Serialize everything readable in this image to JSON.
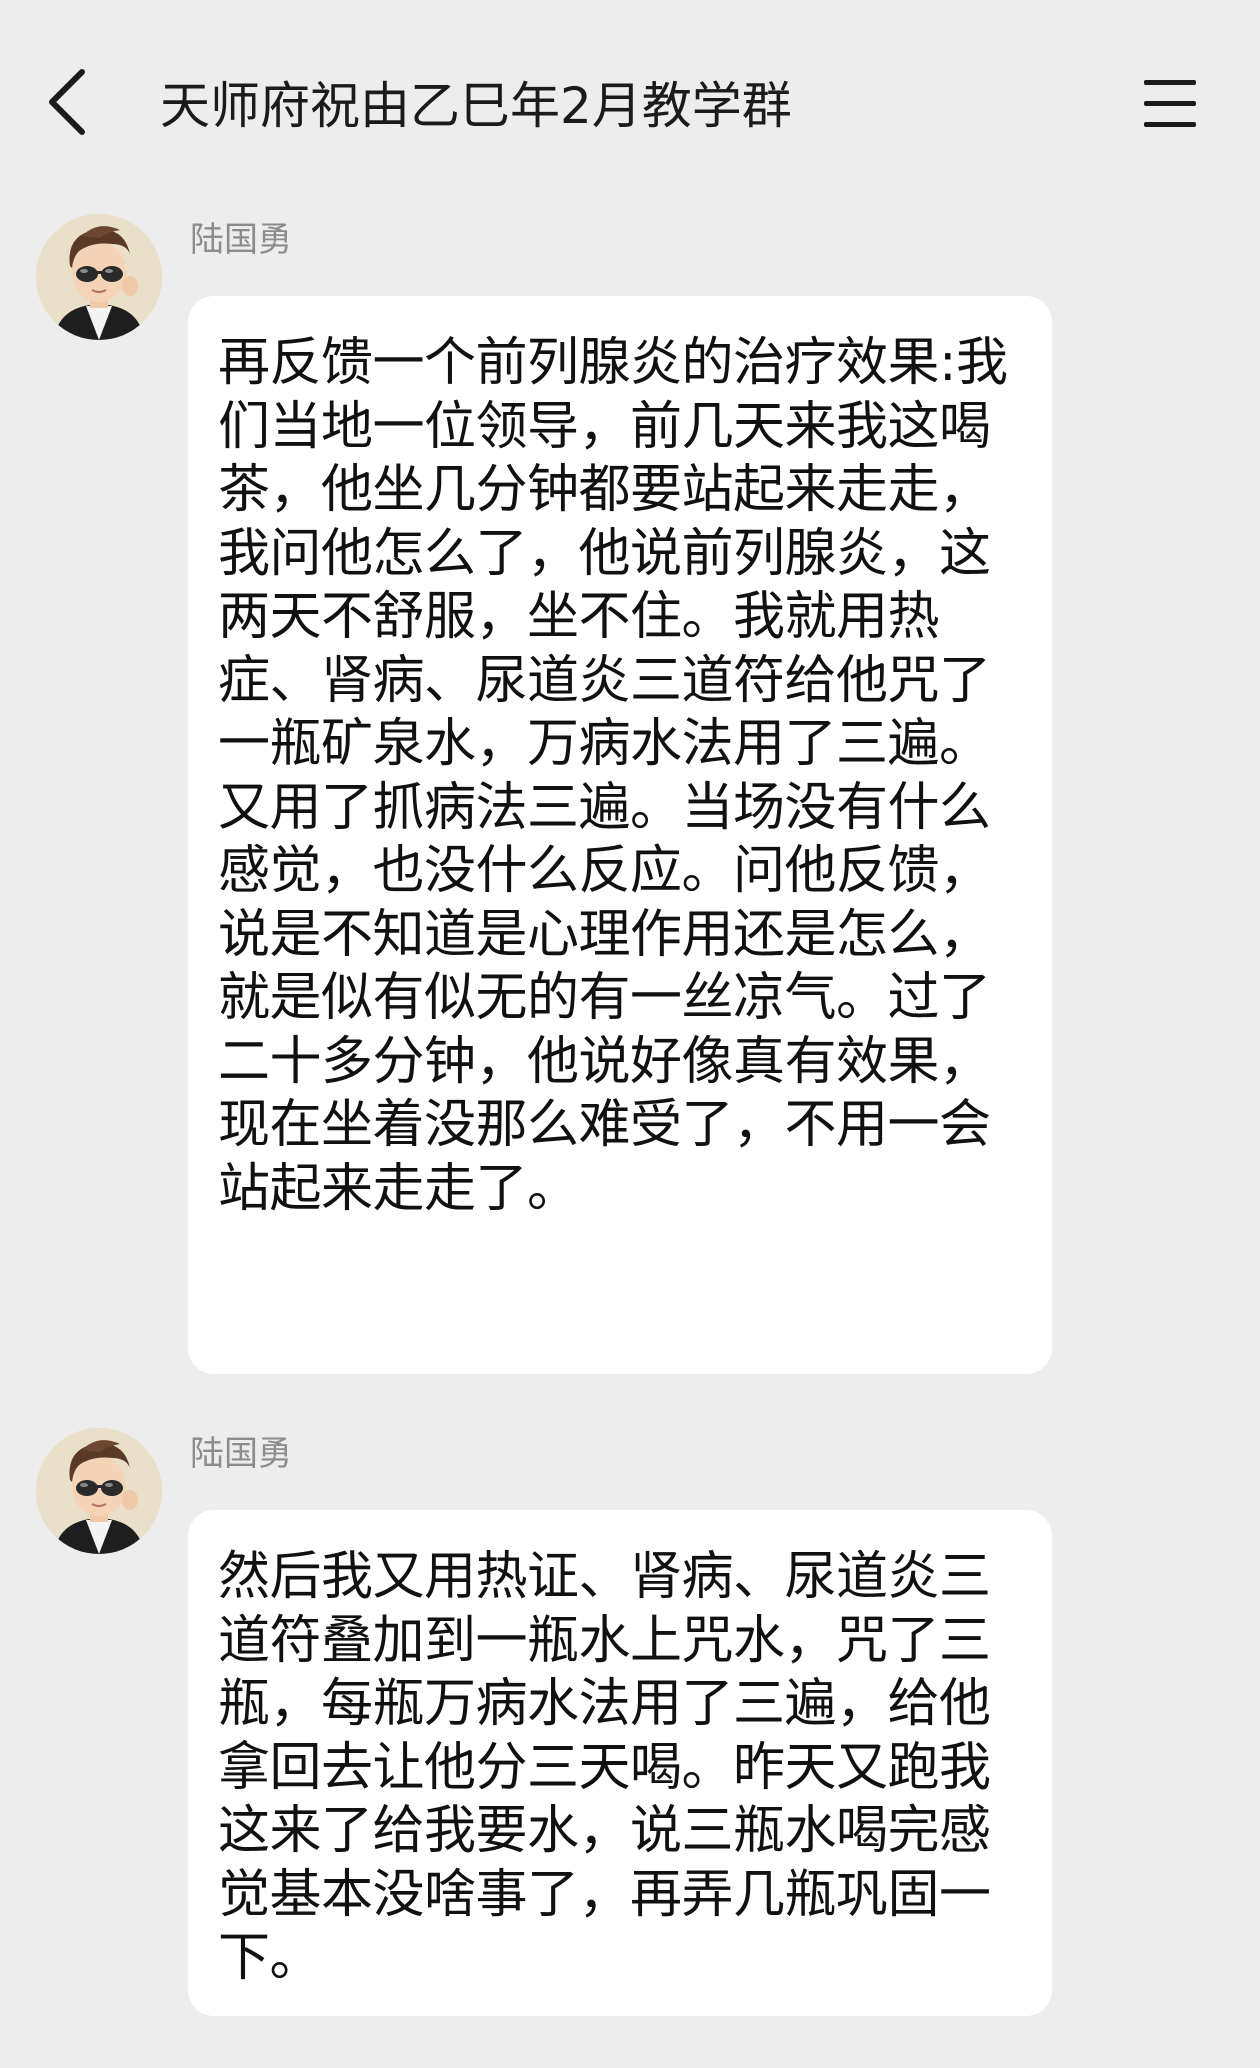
{
  "header": {
    "back_icon": "chevron-left-icon",
    "title": "天师府祝由乙巳年2月教学群",
    "menu_icon": "hamburger-menu-icon"
  },
  "messages": [
    {
      "sender": "陆国勇",
      "avatar_icon": "avatar-boy-sunglasses",
      "text": "再反馈一个前列腺炎的治疗效果:我们当地一位领导，前几天来我这喝茶，他坐几分钟都要站起来走走，我问他怎么了，他说前列腺炎，这两天不舒服，坐不住。我就用热症、肾病、尿道炎三道符给他咒了一瓶矿泉水，万病水法用了三遍。又用了抓病法三遍。当场没有什么感觉，也没什么反应。问他反馈，说是不知道是心理作用还是怎么，就是似有似无的有一丝凉气。过了二十多分钟，他说好像真有效果，现在坐着没那么难受了，不用一会站起来走走了。"
    },
    {
      "sender": "陆国勇",
      "avatar_icon": "avatar-boy-sunglasses",
      "text": "然后我又用热证、肾病、尿道炎三道符叠加到一瓶水上咒水，咒了三瓶，每瓶万病水法用了三遍，给他拿回去让他分三天喝。昨天又跑我这来了给我要水，说三瓶水喝完感觉基本没啥事了，再弄几瓶巩固一下。"
    }
  ],
  "colors": {
    "background": "#ededed",
    "bubble": "#ffffff",
    "text": "#111111",
    "sender": "#8c8c8c"
  }
}
